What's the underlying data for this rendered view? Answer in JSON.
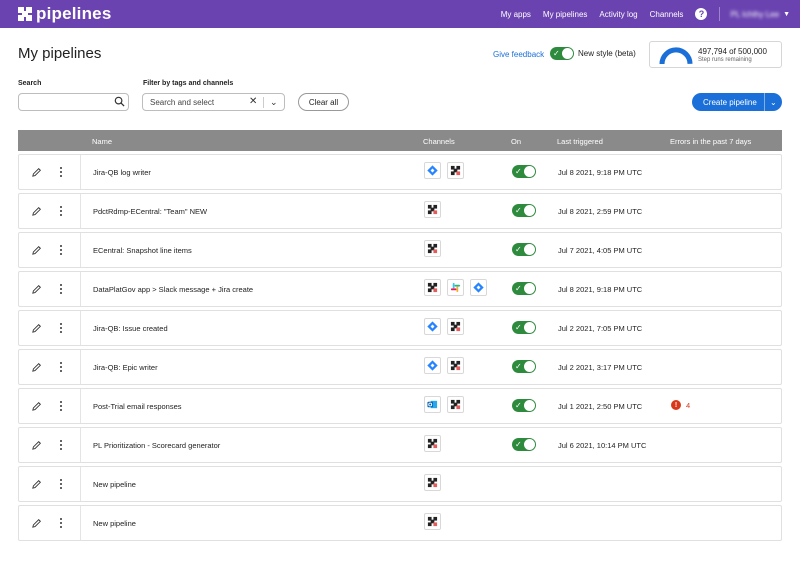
{
  "app": {
    "brand": "pipelines"
  },
  "nav": {
    "links": [
      "My apps",
      "My pipelines",
      "Activity log",
      "Channels"
    ],
    "help": "?",
    "account_name": "PL Ichthy Lee"
  },
  "header": {
    "title": "My pipelines",
    "feedback": "Give feedback",
    "new_style_label": "New style (beta)",
    "usage_count": "497,794 of 500,000",
    "usage_sub": "Step runs remaining",
    "usage_fraction": 0.9956
  },
  "filters": {
    "search_label": "Search",
    "search_value": "",
    "search_placeholder": "",
    "filter_label": "Filter by tags and channels",
    "filter_placeholder": "Search and select",
    "clear_all": "Clear all",
    "create_button": "Create pipeline"
  },
  "table": {
    "columns": [
      "Name",
      "Channels",
      "On",
      "Last triggered",
      "Errors in the past 7 days"
    ],
    "rows": [
      {
        "name": "Jira-QB log writer",
        "channels": [
          "jira-icon",
          "pipelines-icon"
        ],
        "on": true,
        "last_triggered": "Jul 8 2021, 9:18 PM UTC",
        "errors": ""
      },
      {
        "name": "PdctRdmp-ECentral: \"Team\" NEW",
        "channels": [
          "pipelines-icon"
        ],
        "on": true,
        "last_triggered": "Jul 8 2021, 2:59 PM UTC",
        "errors": ""
      },
      {
        "name": "ECentral: Snapshot line items",
        "channels": [
          "pipelines-icon"
        ],
        "on": true,
        "last_triggered": "Jul 7 2021, 4:05 PM UTC",
        "errors": ""
      },
      {
        "name": "DataPlatGov app > Slack message + Jira create",
        "channels": [
          "pipelines-icon",
          "slack-icon",
          "jira-icon"
        ],
        "on": true,
        "last_triggered": "Jul 8 2021, 9:18 PM UTC",
        "errors": ""
      },
      {
        "name": "Jira-QB: Issue created",
        "channels": [
          "jira-icon",
          "pipelines-icon"
        ],
        "on": true,
        "last_triggered": "Jul 2 2021, 7:05 PM UTC",
        "errors": ""
      },
      {
        "name": "Jira-QB: Epic writer",
        "channels": [
          "jira-icon",
          "pipelines-icon"
        ],
        "on": true,
        "last_triggered": "Jul 2 2021, 3:17 PM UTC",
        "errors": ""
      },
      {
        "name": "Post-Trial email responses",
        "channels": [
          "outlook-icon",
          "pipelines-icon"
        ],
        "on": true,
        "last_triggered": "Jul 1 2021, 2:50 PM UTC",
        "errors": "4"
      },
      {
        "name": "PL Prioritization - Scorecard generator",
        "channels": [
          "pipelines-icon"
        ],
        "on": true,
        "last_triggered": "Jul 6 2021, 10:14 PM UTC",
        "errors": ""
      },
      {
        "name": "New pipeline",
        "channels": [
          "pipelines-icon"
        ],
        "on": false,
        "last_triggered": "",
        "errors": ""
      },
      {
        "name": "New pipeline",
        "channels": [
          "pipelines-icon"
        ],
        "on": false,
        "last_triggered": "",
        "errors": ""
      }
    ]
  },
  "colors": {
    "brand": "#6a43b1",
    "accent": "#1a6fd8",
    "toggle_on": "#2e8b3e",
    "error": "#d7381b"
  }
}
